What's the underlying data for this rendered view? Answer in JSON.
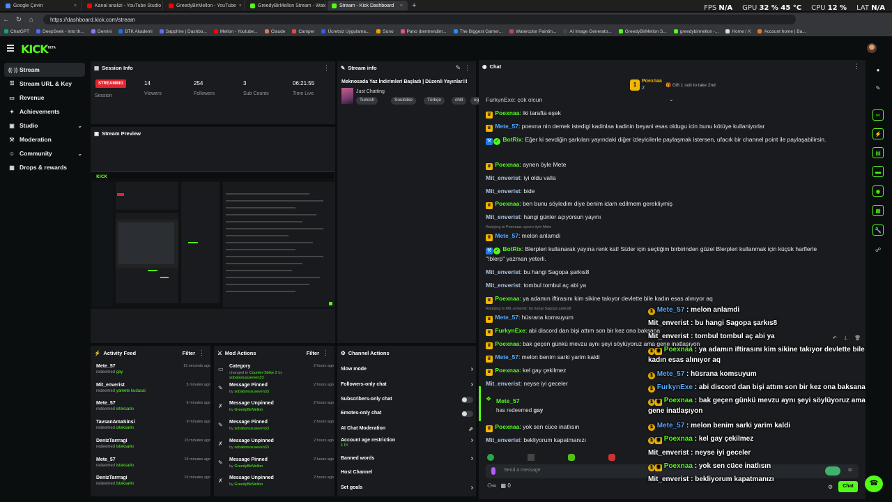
{
  "browser": {
    "tabs": [
      {
        "label": "Google Çeviri",
        "color": "#4a8df6"
      },
      {
        "label": "Kanal analizi - YouTube Studio",
        "color": "#ff0000"
      },
      {
        "label": "GreedyBirMellon - YouTube",
        "color": "#ff0000"
      },
      {
        "label": "GreedyBirMellon Stream - Watch Li",
        "color": "#53fc18"
      },
      {
        "label": "Stream - Kick Dashboard",
        "color": "#53fc18"
      }
    ],
    "url": "https://dashboard.kick.com/stream",
    "hud": {
      "fps_label": "FPS",
      "fps": "N/A",
      "gpu_label": "GPU",
      "gpu": "32 % 45 °C",
      "cpu_label": "CPU",
      "cpu": "12 %",
      "lat_label": "LAT",
      "lat": "N/A"
    },
    "bookmarks": [
      "ChatGPT",
      "DeepSeek - Into th...",
      "Gemini",
      "BTK Akademi",
      "Sapphire | Dashbo...",
      "Mellon - Youtube...",
      "Claude",
      "Camper",
      "Ücretsiz Uygulama...",
      "Suno",
      "Pano (bentrendim...",
      "The Biggest Gamer...",
      "Watercolor Paintin...",
      "AI Image Generato...",
      "GreedyBirMellon S...",
      "greedybirmellon -...",
      "Home / X",
      "Account home | Ba..."
    ]
  },
  "header": {
    "logo": "KICK",
    "logo_beta": "BETA"
  },
  "sidebar": {
    "items": [
      {
        "label": "Stream",
        "icon": "((·))"
      },
      {
        "label": "Stream URL & Key",
        "icon": "⚿"
      },
      {
        "label": "Revenue",
        "icon": "▭"
      },
      {
        "label": "Achievements",
        "icon": "✦"
      },
      {
        "label": "Studio",
        "icon": "▣"
      },
      {
        "label": "Moderation",
        "icon": "⚒"
      },
      {
        "label": "Community",
        "icon": "☺"
      },
      {
        "label": "Drops & rewards",
        "icon": "▦"
      }
    ]
  },
  "session": {
    "title": "Session Info",
    "badge": "STREAMING",
    "badge_label": "Session",
    "stats": [
      {
        "value": "14",
        "label": "Viewers"
      },
      {
        "value": "254",
        "label": "Followers"
      },
      {
        "value": "3",
        "label": "Sub Counts"
      },
      {
        "value": "06:21:55",
        "label": "Time Live"
      }
    ]
  },
  "preview": {
    "title": "Stream Preview"
  },
  "stream_info": {
    "title": "Stream info",
    "stream_title": "Meknosada Yaz İndirimleri Başladı | Düzenli Yayınlar!!!",
    "category": "Just Chatting",
    "tags": [
      "Turkish",
      "Soulslike",
      "Türkçe",
      "chill",
      "eglence"
    ]
  },
  "activity": {
    "title": "Activity Feed",
    "filter": "Filter",
    "items": [
      {
        "name": "Mete_57",
        "action": "redeemed",
        "reward": "gay",
        "time": "15 seconds ago"
      },
      {
        "name": "Mit_enverist",
        "action": "redeemed",
        "reward": "yamete kudasai",
        "time": "5 minutes ago"
      },
      {
        "name": "Mete_57",
        "action": "redeemed",
        "reward": "isteksarkı",
        "time": "6 minutes ago"
      },
      {
        "name": "TavsanAmaSinsi",
        "action": "redeemed",
        "reward": "isteksarkı",
        "time": "9 minutes ago"
      },
      {
        "name": "DenizTarrragi",
        "action": "redeemed",
        "reward": "isteksarkı",
        "time": "15 minutes ago"
      },
      {
        "name": "Mete_57",
        "action": "redeemed",
        "reward": "isteksarkı",
        "time": "15 minutes ago"
      },
      {
        "name": "DenizTarrragi",
        "action": "redeemed",
        "reward": "isteksarkı",
        "time": "16 minutes ago"
      }
    ]
  },
  "mod_actions": {
    "title": "Mod Actions",
    "filter": "Filter",
    "items": [
      {
        "icon": "▭",
        "title": "Category",
        "pre": "changed to ",
        "hl": "Counter-Strike 2",
        "mid": " by ",
        "by": "sobaborususeven33",
        "time": "2 hours ago"
      },
      {
        "icon": "✎",
        "title": "Message Pinned",
        "pre": "",
        "hl": "",
        "mid": "by ",
        "by": "sobaborususeven33",
        "time": "2 hours ago"
      },
      {
        "icon": "✗",
        "title": "Message Unpinned",
        "pre": "",
        "hl": "",
        "mid": "by ",
        "by": "GreedyBirMellon",
        "time": "2 hours ago"
      },
      {
        "icon": "✎",
        "title": "Message Pinned",
        "pre": "",
        "hl": "",
        "mid": "by ",
        "by": "sobaborususeven33",
        "time": "2 hours ago"
      },
      {
        "icon": "✗",
        "title": "Message Unpinned",
        "pre": "",
        "hl": "",
        "mid": "by ",
        "by": "sobaborususeven33",
        "time": "2 hours ago"
      },
      {
        "icon": "✎",
        "title": "Message Pinned",
        "pre": "",
        "hl": "",
        "mid": "by ",
        "by": "GreedyBirMellon",
        "time": "2 hours ago"
      },
      {
        "icon": "✗",
        "title": "Message Unpinned",
        "pre": "",
        "hl": "",
        "mid": "by ",
        "by": "GreedyBirMellon",
        "time": "2 hours ago"
      }
    ]
  },
  "channel_actions": {
    "title": "Channel Actions",
    "items": [
      {
        "label": "Slow mode",
        "kind": "arrow",
        "sub": ""
      },
      {
        "label": "Followers-only chat",
        "kind": "arrow",
        "sub": ""
      },
      {
        "label": "Subscribers-only chat",
        "kind": "toggle",
        "sub": ""
      },
      {
        "label": "Emotes-only chat",
        "kind": "toggle",
        "sub": ""
      },
      {
        "label": "AI Chat Moderation",
        "kind": "ext",
        "sub": ""
      },
      {
        "label": "Account age restriction",
        "kind": "arrow",
        "sub": "1 hr"
      },
      {
        "label": "Banned words",
        "kind": "arrow",
        "sub": ""
      },
      {
        "label": "Host Channel",
        "kind": "none",
        "sub": ""
      },
      {
        "label": "Set goals",
        "kind": "arrow",
        "sub": ""
      }
    ]
  },
  "chat": {
    "title": "Chat",
    "top_gifter": "Poexnaa",
    "top_gifter_count": "2",
    "gift_hint": "Gift 1 sub to take 2nd",
    "partial_top": "FurkynExe: çok olcun",
    "messages": [
      {
        "user": "Poexnaa",
        "color": "#53fc18",
        "badges": "crown",
        "text": "iki tarafta eşek"
      },
      {
        "user": "Mete_57",
        "color": "#53a8ff",
        "badges": "crown",
        "text": "poexna nin demek istedigi kadinlaa kadinin beyani esas oldugu icin bunu kötüye kullaniyorlar"
      },
      {
        "user": "BotRix",
        "color": "#53fc18",
        "badges": "bot",
        "text": "Eğer ki sevdiğin şarkıları yayındaki diğer izleyicilerle paylaşmak istersen, ufacık bir channel point ile paylaşabilirsin."
      },
      {
        "user": "Poexnaa",
        "color": "#53fc18",
        "badges": "crown",
        "text": "aynen öyle Mete"
      },
      {
        "user": "Mit_enverist",
        "color": "#b0c4de",
        "badges": "",
        "text": "iyi oldu valla"
      },
      {
        "user": "Mit_enverist",
        "color": "#b0c4de",
        "badges": "",
        "text": "bide"
      },
      {
        "user": "Poexnaa",
        "color": "#53fc18",
        "badges": "crown",
        "text": "ben bunu söyledim diye benim idam edilmem gerekliymiş"
      },
      {
        "user": "Mit_enverist",
        "color": "#b0c4de",
        "badges": "",
        "text": "hangi günler açıyorsun yayını"
      },
      {
        "reply": "Replying to Poexnaa: aynen öyle Mete",
        "user": "Mete_57",
        "color": "#53a8ff",
        "badges": "crown",
        "text": "melon anlamdi"
      },
      {
        "user": "BotRix",
        "color": "#53fc18",
        "badges": "bot",
        "text": "Blerpleri kullanarak yayına renk kat! Sizler için seçtiğim birbirinden güzel Blerpleri kullanmak için küçük harflerle \"!blerp\" yazman yeterli."
      },
      {
        "user": "Mit_enverist",
        "color": "#b0c4de",
        "badges": "",
        "text": "bu hangi Sagopa şarkıs8"
      },
      {
        "user": "Mit_enverist",
        "color": "#b0c4de",
        "badges": "",
        "text": "tombul tombul aç abi ya"
      },
      {
        "user": "Poexnaa",
        "color": "#53fc18",
        "badges": "crown",
        "text": "ya adamın iftirasını kim sikine takıyor devlette bile kadın esas alınıyor aq"
      },
      {
        "reply": "Replying to Mit_enverist: bu hangi Sagopa şarkıs8",
        "user": "Mete_57",
        "color": "#53a8ff",
        "badges": "crown",
        "text": "hüsrana komsuyum"
      },
      {
        "user": "FurkynExe",
        "color": "#53fc18",
        "badges": "crown",
        "text": "abi discord dan bişi attım son bir kez ona baksana"
      },
      {
        "user": "Poexnaa",
        "color": "#53fc18",
        "badges": "crown",
        "text": "bak geçen günkü mevzu aynı şeyi söylüyoruz ama gene inatlaşıyon"
      },
      {
        "user": "Mete_57",
        "color": "#53a8ff",
        "badges": "crown",
        "text": "melon benim sarki yarim kaldi"
      },
      {
        "user": "Poexnaa",
        "color": "#53fc18",
        "badges": "crown",
        "text": "kel gay çekilmez"
      },
      {
        "user": "Mit_enverist",
        "color": "#b0c4de",
        "badges": "",
        "text": "neyse iyi geceler"
      }
    ],
    "redeem": {
      "user": "Mete_57",
      "text": "has redeemed",
      "reward": "gay"
    },
    "after": [
      {
        "user": "Poexnaa",
        "color": "#53fc18",
        "badges": "crown",
        "text": "yok sen cüce inatlısın"
      },
      {
        "user": "Mit_enverist",
        "color": "#b0c4de",
        "badges": "",
        "text": "bekliyorum kapatmanızı"
      }
    ],
    "input_placeholder": "Send a message",
    "points": "0",
    "send_label": "Chat"
  },
  "overlay": {
    "messages": [
      {
        "user": "Mete_57",
        "style": "ub",
        "badges": 1,
        "text": "melon anlamdi"
      },
      {
        "user": "Mit_enverist",
        "style": "u",
        "badges": 0,
        "text": "bu hangi Sagopa şarkıs8"
      },
      {
        "user": "Mit_enverist",
        "style": "u",
        "badges": 0,
        "text": "tombul tombul aç abi ya"
      },
      {
        "user": "Poexnaa",
        "style": "up",
        "badges": 2,
        "text": "ya adamın iftirasını kim sikine takıyor devlette bile kadın esas alınıyor aq"
      },
      {
        "user": "Mete_57",
        "style": "ub",
        "badges": 1,
        "text": "hüsrana komsuyum"
      },
      {
        "user": "FurkynExe",
        "style": "ub",
        "badges": 1,
        "text": "abi discord dan bişi attım son bir kez ona baksana"
      },
      {
        "user": "Poexnaa",
        "style": "up",
        "badges": 2,
        "text": "bak geçen günkü mevzu aynı şeyi söylüyoruz ama gene inatlaşıyon"
      },
      {
        "user": "Mete_57",
        "style": "ub",
        "badges": 1,
        "text": "melon benim sarki yarim kaldi"
      },
      {
        "user": "Poexnaa",
        "style": "up",
        "badges": 2,
        "text": "kel gay çekilmez"
      },
      {
        "user": "Mit_enverist",
        "style": "u",
        "badges": 0,
        "text": "neyse iyi geceler"
      },
      {
        "user": "Poexnaa",
        "style": "up",
        "badges": 2,
        "text": "yok sen cüce inatlısın"
      },
      {
        "user": "Mit_enverist",
        "style": "u",
        "badges": 0,
        "text": "bekliyorum kapatmanızı"
      }
    ]
  },
  "colors": {
    "accent": "#53fc18",
    "streaming": "#e5232d",
    "panel": "#191b1f",
    "bg": "#0b0e0f"
  }
}
